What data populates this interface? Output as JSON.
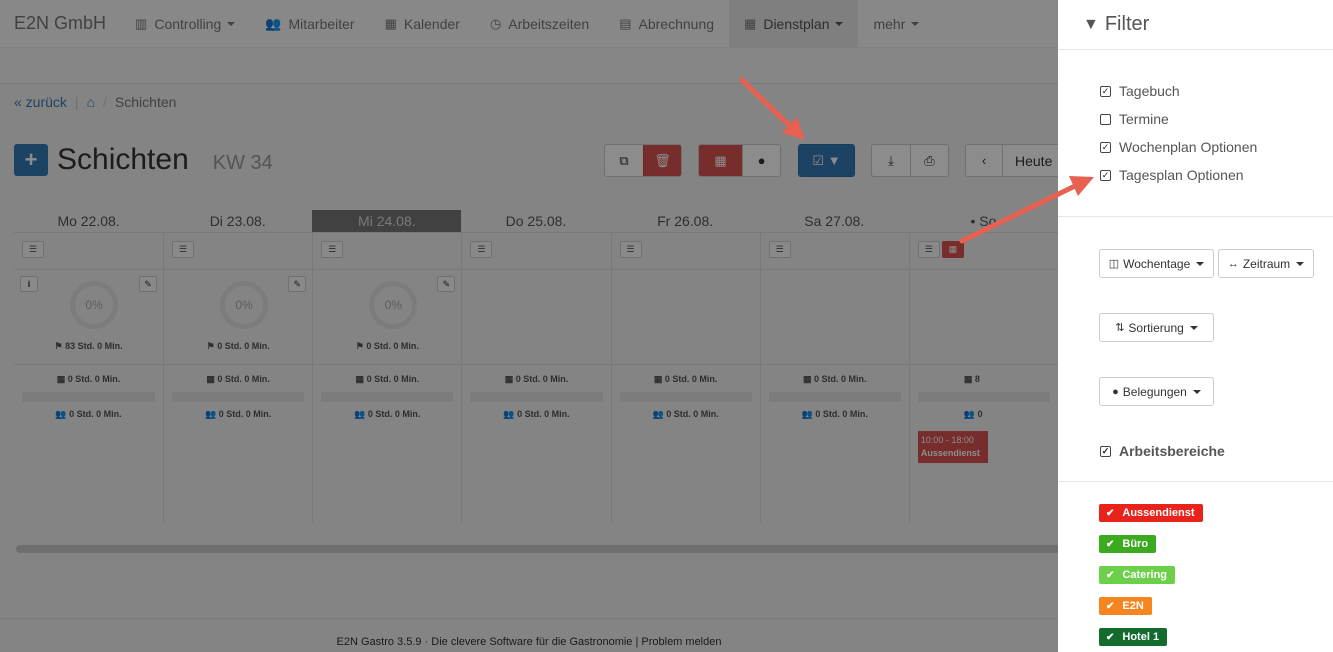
{
  "nav": {
    "brand": "E2N GmbH",
    "items": [
      {
        "label": "Controlling",
        "icon": "bar-chart-icon"
      },
      {
        "label": "Mitarbeiter",
        "icon": "users-icon"
      },
      {
        "label": "Kalender",
        "icon": "calendar-icon"
      },
      {
        "label": "Arbeitszeiten",
        "icon": "clock-icon"
      },
      {
        "label": "Abrechnung",
        "icon": "calculator-icon"
      },
      {
        "label": "Dienstplan",
        "icon": "calendar-check-icon"
      },
      {
        "label": "mehr"
      }
    ]
  },
  "breadcrumb": {
    "back": "« zurück",
    "current": "Schichten"
  },
  "header": {
    "title": "Schichten",
    "week": "KW 34",
    "add": "+"
  },
  "toolbar": {
    "today": "Heute"
  },
  "days": [
    "Mo 22.08.",
    "Di 23.08.",
    "Mi 24.08.",
    "Do 25.08.",
    "Fr 26.08.",
    "Sa 27.08.",
    "• So"
  ],
  "percent": "0%",
  "hours_flag": [
    "83 Std. 0 Min.",
    "0 Std. 0 Min.",
    "0 Std. 0 Min."
  ],
  "hours_zero": "0 Std. 0 Min.",
  "hours_cut": "8",
  "hours_cut2": "0",
  "shift": {
    "time": "10:00 - 18:00",
    "area": "Aussendienst"
  },
  "footer": {
    "text": "E2N Gastro 3.5.9 · Die clevere Software für die Gastronomie | Problem melden"
  },
  "filter": {
    "title": "Filter",
    "checks": [
      {
        "label": "Tagebuch",
        "checked": true
      },
      {
        "label": "Termine",
        "checked": false
      },
      {
        "label": "Wochenplan Optionen",
        "checked": true
      },
      {
        "label": "Tagesplan Optionen",
        "checked": true
      }
    ],
    "buttons": {
      "wochentage": "Wochentage",
      "zeitraum": "Zeitraum",
      "sortierung": "Sortierung",
      "belegungen": "Belegungen"
    },
    "section": "Arbeitsbereiche",
    "tags": [
      {
        "label": "Aussendienst",
        "color": "#e8231c"
      },
      {
        "label": "Büro",
        "color": "#3caa1e"
      },
      {
        "label": "Catering",
        "color": "#6cd04b"
      },
      {
        "label": "E2N",
        "color": "#f5851f"
      },
      {
        "label": "Hotel 1",
        "color": "#136b2e"
      }
    ]
  },
  "colors": {
    "primary": "#337ab7",
    "danger": "#d9534f",
    "arrow": "#e8604f"
  }
}
